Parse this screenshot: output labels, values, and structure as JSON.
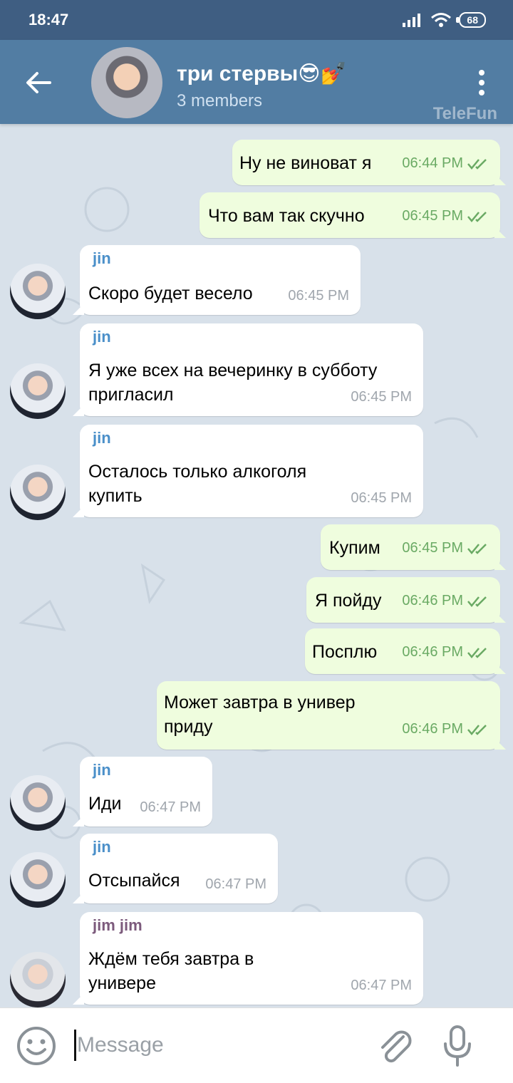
{
  "status_bar": {
    "time": "18:47",
    "battery": "68"
  },
  "header": {
    "title": "три стервы😎💅",
    "subtitle": "3 members"
  },
  "watermark": "TeleFun",
  "messages": [
    {
      "text": "Ну не виноват я",
      "time": "06:44 PM"
    },
    {
      "text": "Что вам так скучно",
      "time": "06:45 PM"
    },
    {
      "sender": "jin",
      "text": "Скоро будет весело",
      "time": "06:45 PM"
    },
    {
      "sender": "jin",
      "line1": "Я уже всех на вечеринку в субботу",
      "line2": "пригласил",
      "time": "06:45 PM"
    },
    {
      "sender": "jin",
      "line1": "Осталось только алкоголя",
      "line2": "купить",
      "time": "06:45 PM"
    },
    {
      "text": "Купим",
      "time": "06:45 PM"
    },
    {
      "text": "Я пойду",
      "time": "06:46 PM"
    },
    {
      "text": "Посплю",
      "time": "06:46 PM"
    },
    {
      "line1": "Может завтра в универ",
      "line2": "приду",
      "time": "06:46 PM"
    },
    {
      "sender": "jin",
      "text": "Иди",
      "time": "06:47 PM"
    },
    {
      "sender": "jin",
      "text": "Отсыпайся",
      "time": "06:47 PM"
    },
    {
      "sender": "jim jim",
      "line1": "Ждём тебя завтра в",
      "line2": "универе",
      "time": "06:47 PM"
    }
  ],
  "input": {
    "placeholder": "Message"
  },
  "colors": {
    "header": "#527da3",
    "status_bar": "#3f5e82",
    "outgoing_bubble": "#effdde",
    "check": "#6aaa64",
    "sender_name": "#4a8fc9"
  }
}
